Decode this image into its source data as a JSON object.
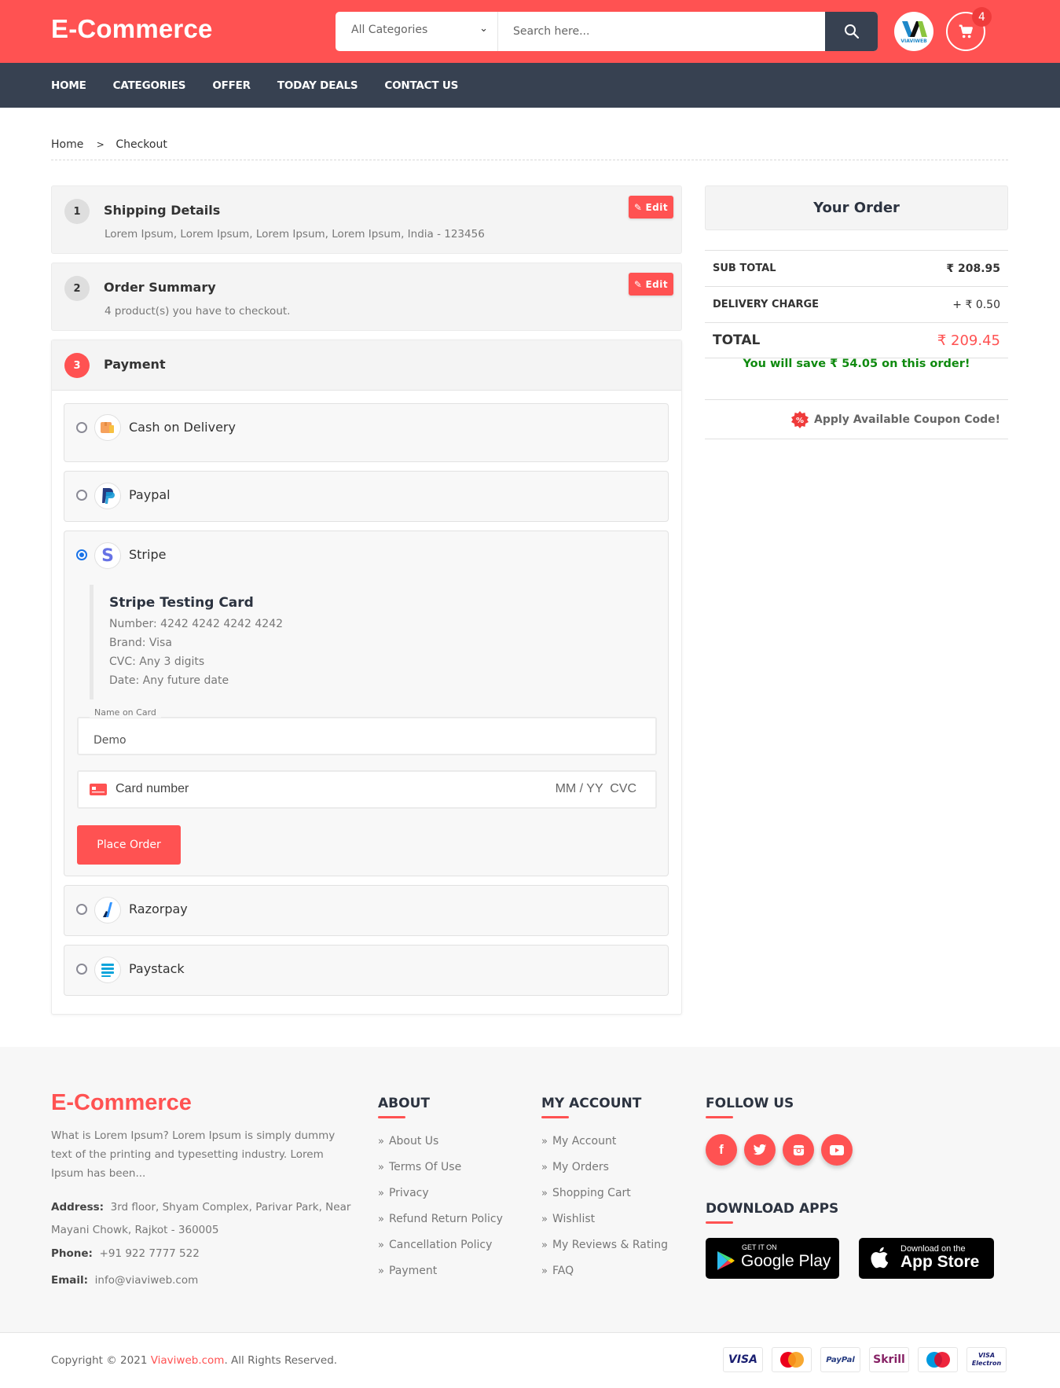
{
  "header": {
    "logo": "E-Commerce",
    "category_select": "All Categories",
    "search_placeholder": "Search here...",
    "avatar_text": "VIAVIWEB",
    "cart_count": "4"
  },
  "nav": [
    "HOME",
    "CATEGORIES",
    "OFFER",
    "TODAY DEALS",
    "CONTACT US"
  ],
  "breadcrumb": {
    "home": "Home",
    "separator": ">",
    "current": "Checkout"
  },
  "steps": [
    {
      "num": "1",
      "title": "Shipping Details",
      "desc": "Lorem Ipsum, Lorem Ipsum, Lorem Ipsum, Lorem Ipsum, India - 123456",
      "edit": "Edit"
    },
    {
      "num": "2",
      "title": "Order Summary",
      "desc": "4 product(s) you have to checkout.",
      "edit": "Edit"
    },
    {
      "num": "3",
      "title": "Payment"
    }
  ],
  "payment_methods": [
    {
      "label": "Cash on Delivery",
      "icon": "cash-delivery-icon",
      "selected": false
    },
    {
      "label": "Paypal",
      "icon": "paypal-icon",
      "selected": false
    },
    {
      "label": "Stripe",
      "icon": "stripe-icon",
      "selected": true
    },
    {
      "label": "Razorpay",
      "icon": "razorpay-icon",
      "selected": false
    },
    {
      "label": "Paystack",
      "icon": "paystack-icon",
      "selected": false
    }
  ],
  "stripe": {
    "test_card_title": "Stripe Testing Card",
    "number": "Number: 4242 4242 4242 4242",
    "brand": "Brand: Visa",
    "cvc": "CVC: Any 3 digits",
    "date": "Date: Any future date",
    "name_label": "Name on Card",
    "name_value": "Demo",
    "card_placeholder": "Card number",
    "exp_cvc_placeholder": "MM / YY  CVC",
    "place_order": "Place Order"
  },
  "order": {
    "title": "Your Order",
    "sub_total_label": "SUB TOTAL",
    "sub_total": "₹ 208.95",
    "delivery_label": "DELIVERY CHARGE",
    "delivery": "+ ₹ 0.50",
    "total_label": "TOTAL",
    "total": "₹ 209.45",
    "savings": "You will save ₹ 54.05 on this order!",
    "coupon": "Apply Available Coupon Code!"
  },
  "footer": {
    "logo": "E-Commerce",
    "description": "What is Lorem Ipsum? Lorem Ipsum is simply dummy text of the printing and typesetting industry. Lorem Ipsum has been...",
    "address_label": "Address:",
    "address": "3rd floor, Shyam Complex, Parivar Park, Near Mayani Chowk, Rajkot - 360005",
    "phone_label": "Phone:",
    "phone": "+91 922 7777 522",
    "email_label": "Email:",
    "email": "info@viaviweb.com",
    "about_title": "ABOUT",
    "about_links": [
      "About Us",
      "Terms Of Use",
      "Privacy",
      "Refund Return Policy",
      "Cancellation Policy",
      "Payment"
    ],
    "account_title": "MY ACCOUNT",
    "account_links": [
      "My Account",
      "My Orders",
      "Shopping Cart",
      "Wishlist",
      "My Reviews & Rating",
      "FAQ"
    ],
    "follow_title": "FOLLOW US",
    "apps_title": "DOWNLOAD APPS",
    "google_small": "GET IT ON",
    "google_big": "Google Play",
    "apple_small": "Download on the",
    "apple_big": "App Store",
    "copyright_pre": "Copyright © 2021 ",
    "copyright_link": "Viaviweb.com",
    "copyright_post": ". All Rights Reserved.",
    "payment_cards": [
      "VISA",
      "MasterCard",
      "PayPal",
      "Skrill",
      "Maestro",
      "VISA Electron"
    ]
  },
  "colors": {
    "brand": "#ff5252",
    "dark": "#374151",
    "success": "#0f8a0f",
    "radio_selected": "#1a73e8"
  }
}
